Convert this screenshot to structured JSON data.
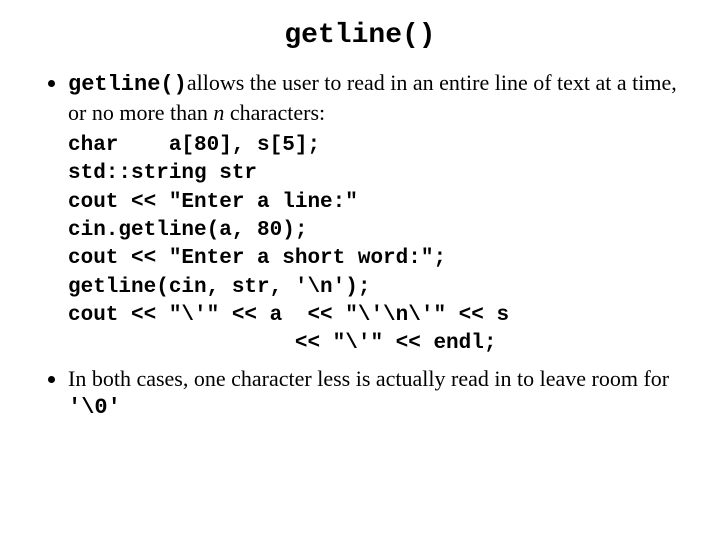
{
  "title": "getline()",
  "bullet1": {
    "mono": "getline()",
    "pre_n": "allows the user to read in an entire line of text at a time, or no more than ",
    "n": "n",
    "post_n": " characters:"
  },
  "code": {
    "l1": "char    a[80], s[5];",
    "l2": "std::string str",
    "l3": "cout << \"Enter a line:\"",
    "l4": "cin.getline(a, 80);",
    "l5": "cout << \"Enter a short word:\";",
    "l6": "getline(cin, str, '\\n');",
    "l7": "cout << \"\\'\" << a  << \"\\'\\n\\'\" << s",
    "l8": "                  << \"\\'\" << endl;"
  },
  "bullet2": {
    "text": "In both cases, one character less is actually read in to leave room for ",
    "mono": "'\\0'"
  }
}
